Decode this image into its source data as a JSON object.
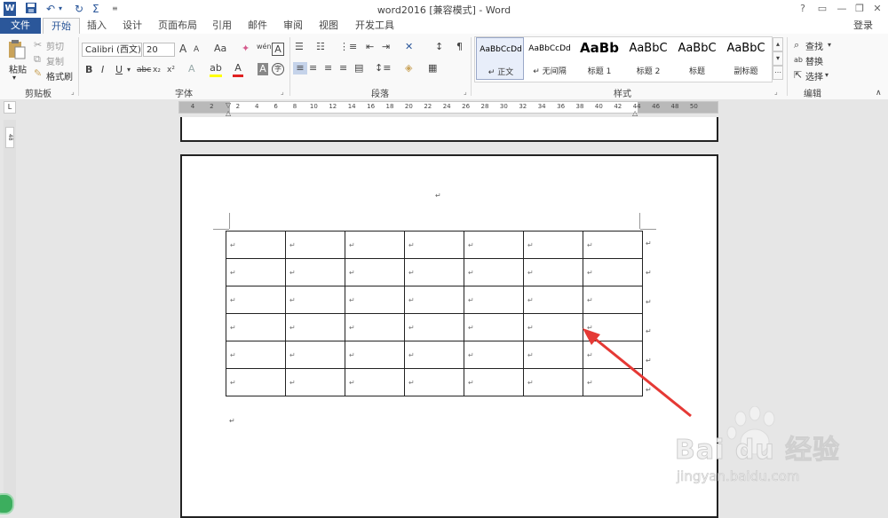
{
  "titlebar": {
    "title": "word2016 [兼容模式] - Word",
    "app_icon": "W",
    "help": "?",
    "minimize": "—",
    "restore": "❐",
    "close": "✕",
    "ribbon_display": "▭"
  },
  "tabs": {
    "file": "文件",
    "items": [
      "开始",
      "插入",
      "设计",
      "页面布局",
      "引用",
      "邮件",
      "审阅",
      "视图",
      "开发工具"
    ],
    "login": "登录"
  },
  "ribbon": {
    "clipboard": {
      "paste": "粘贴",
      "cut": "剪切",
      "copy": "复制",
      "format_painter": "格式刷",
      "group": "剪贴板"
    },
    "font": {
      "font_name": "Calibri (西文)",
      "font_size": "20",
      "group": "字体",
      "bold": "B",
      "italic": "I",
      "underline": "U",
      "strike": "abc",
      "subscript": "x₂",
      "superscript": "x²",
      "grow": "A",
      "shrink": "A",
      "case": "Aa",
      "pinyin": "wén",
      "font_color_letter": "A",
      "char_shade": "A",
      "enclose": "字"
    },
    "paragraph": {
      "group": "段落"
    },
    "styles": {
      "group": "样式",
      "items": [
        {
          "sample": "AaBbCcDd",
          "name": "↵ 正文"
        },
        {
          "sample": "AaBbCcDd",
          "name": "↵ 无间隔"
        },
        {
          "sample": "AaBb",
          "name": "标题 1"
        },
        {
          "sample": "AaBbC",
          "name": "标题 2"
        },
        {
          "sample": "AaBbC",
          "name": "标题"
        },
        {
          "sample": "AaBbC",
          "name": "副标题"
        }
      ]
    },
    "editing": {
      "group": "编辑",
      "find": "查找",
      "replace": "替换",
      "select": "选择"
    }
  },
  "ruler": {
    "ticks": [
      "4",
      "2",
      "2",
      "4",
      "6",
      "8",
      "10",
      "12",
      "14",
      "16",
      "18",
      "20",
      "22",
      "24",
      "26",
      "28",
      "30",
      "32",
      "34",
      "36",
      "38",
      "40",
      "42",
      "44",
      "46",
      "48",
      "50"
    ],
    "tab_selector": "L",
    "vertical_label": "48"
  },
  "document": {
    "para_mark": "↵",
    "rows": 6,
    "cols": 7
  },
  "watermark": {
    "brand": "Bai du 经验",
    "url": "jingyan.baidu.com"
  },
  "colors": {
    "accent": "#2b579a",
    "arrow": "#e53935"
  }
}
